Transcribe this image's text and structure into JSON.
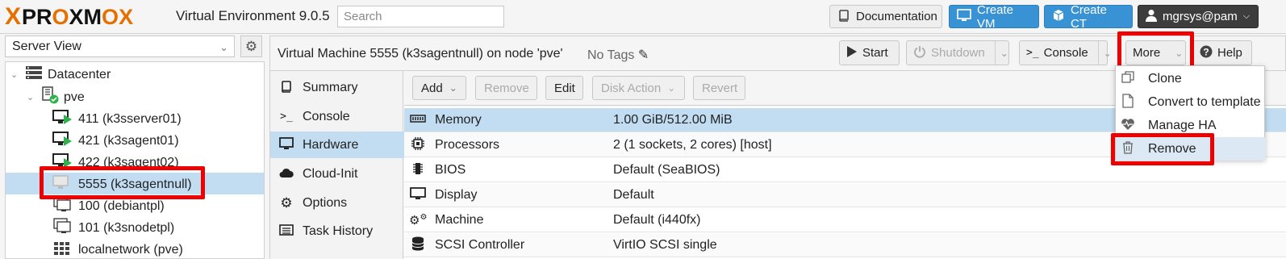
{
  "topbar": {
    "logo_text_pro": "PR",
    "logo_text_o": "O",
    "logo_text_rest": "XM",
    "logo_text_o2": "O",
    "logo_text_x": "X",
    "logo_x": "X",
    "product": "Virtual Environment 9.0.5",
    "search_placeholder": "Search",
    "documentation": "Documentation",
    "create_vm": "Create VM",
    "create_ct": "Create CT",
    "user": "mgrsys@pam"
  },
  "left": {
    "view_select": "Server View",
    "tree": [
      {
        "label": "Datacenter",
        "icon": "server-rack-icon"
      },
      {
        "label": "pve",
        "icon": "node-icon"
      },
      {
        "label": "411 (k3sserver01)",
        "icon": "vm-running-icon"
      },
      {
        "label": "421 (k3sagent01)",
        "icon": "vm-running-icon"
      },
      {
        "label": "422 (k3sagent02)",
        "icon": "vm-running-icon"
      },
      {
        "label": "5555 (k3sagentnull)",
        "icon": "vm-stopped-icon"
      },
      {
        "label": "100 (debiantpl)",
        "icon": "template-icon"
      },
      {
        "label": "101 (k3snodetpl)",
        "icon": "template-icon"
      },
      {
        "label": "localnetwork (pve)",
        "icon": "network-grid-icon"
      }
    ]
  },
  "header": {
    "vm_title": "Virtual Machine 5555 (k3sagentnull) on node 'pve'",
    "no_tags": "No Tags",
    "start": "Start",
    "shutdown": "Shutdown",
    "console": "Console",
    "more": "More",
    "help": "Help"
  },
  "subnav": [
    {
      "label": "Summary",
      "icon": "book-icon"
    },
    {
      "label": "Console",
      "icon": "terminal-icon"
    },
    {
      "label": "Hardware",
      "icon": "monitor-icon"
    },
    {
      "label": "Cloud-Init",
      "icon": "cloud-icon"
    },
    {
      "label": "Options",
      "icon": "gear-icon"
    },
    {
      "label": "Task History",
      "icon": "list-icon"
    }
  ],
  "toolbar": {
    "add": "Add",
    "remove": "Remove",
    "edit": "Edit",
    "disk_action": "Disk Action",
    "revert": "Revert"
  },
  "hardware": [
    {
      "key": "Memory",
      "value": "1.00 GiB/512.00 MiB",
      "icon": "memory-icon"
    },
    {
      "key": "Processors",
      "value": "2 (1 sockets, 2 cores) [host]",
      "icon": "cpu-icon"
    },
    {
      "key": "BIOS",
      "value": "Default (SeaBIOS)",
      "icon": "bios-chip-icon"
    },
    {
      "key": "Display",
      "value": "Default",
      "icon": "display-icon"
    },
    {
      "key": "Machine",
      "value": "Default (i440fx)",
      "icon": "cogs-icon"
    },
    {
      "key": "SCSI Controller",
      "value": "VirtIO SCSI single",
      "icon": "database-icon"
    }
  ],
  "more_menu": [
    {
      "label": "Clone",
      "icon": "clone-icon"
    },
    {
      "label": "Convert to template",
      "icon": "file-icon"
    },
    {
      "label": "Manage HA",
      "icon": "heartbeat-icon"
    },
    {
      "label": "Remove",
      "icon": "trash-icon"
    }
  ],
  "colors": {
    "accent_blue": "#3892d4",
    "selection": "#c2ddf2",
    "logo_orange": "#e57000",
    "highlight_red": "#ee0000",
    "running_green": "#2db34a"
  }
}
